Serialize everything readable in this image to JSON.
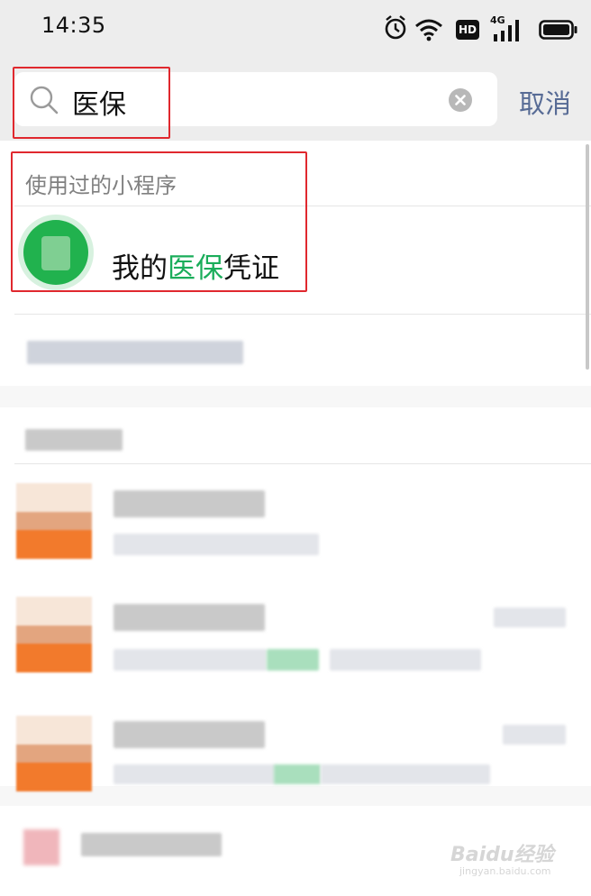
{
  "status_bar": {
    "time": "14:35",
    "icons": [
      "alarm-icon",
      "wifi-icon",
      "hd-icon",
      "4g-signal-icon",
      "battery-icon"
    ],
    "hd_label": "HD",
    "network_label": "4G"
  },
  "search": {
    "query": "医保",
    "cancel_label": "取消"
  },
  "mini_programs": {
    "section_title": "使用过的小程序",
    "items": [
      {
        "name_prefix": "我的",
        "name_highlight": "医保",
        "name_suffix": "凭证",
        "icon": "medical-insurance-app-icon"
      }
    ]
  },
  "colors": {
    "highlight_green": "#1aad5a",
    "cancel_blue": "#576b95",
    "annotation_red": "#e0282e"
  },
  "watermark": {
    "brand": "Baidu经验",
    "url": "jingyan.baidu.com"
  }
}
